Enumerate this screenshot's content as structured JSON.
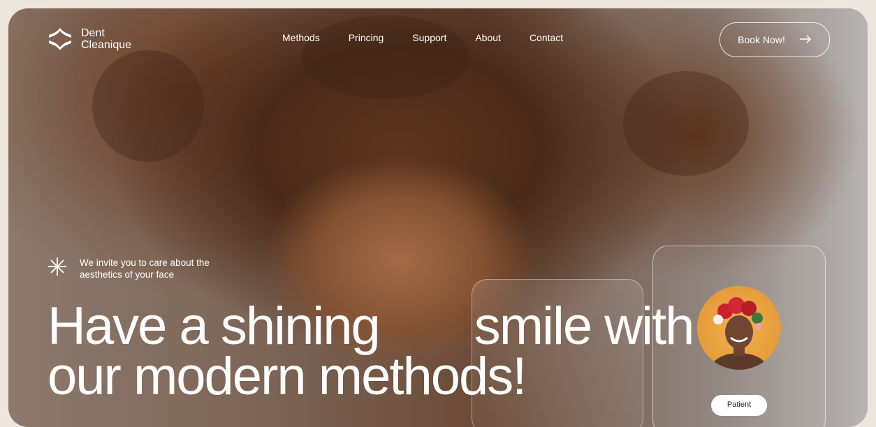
{
  "brand": {
    "line1": "Dent",
    "line2": "Cleanique"
  },
  "nav": {
    "items": [
      "Methods",
      "Princing",
      "Support",
      "About",
      "Contact"
    ]
  },
  "cta": {
    "label": "Book Now!",
    "icon": "arrow-right-icon"
  },
  "tagline": {
    "icon": "asterisk-icon",
    "text": "We invite you to care about the aesthetics of your face"
  },
  "headline": {
    "line1a": "Have a shining",
    "line1b": "smile with",
    "line2": "our modern methods!"
  },
  "pill": {
    "label": "Patient"
  },
  "colors": {
    "text": "#ffffff",
    "page_bg": "#ece6dc",
    "avatar_bg": "#f0a94a"
  }
}
